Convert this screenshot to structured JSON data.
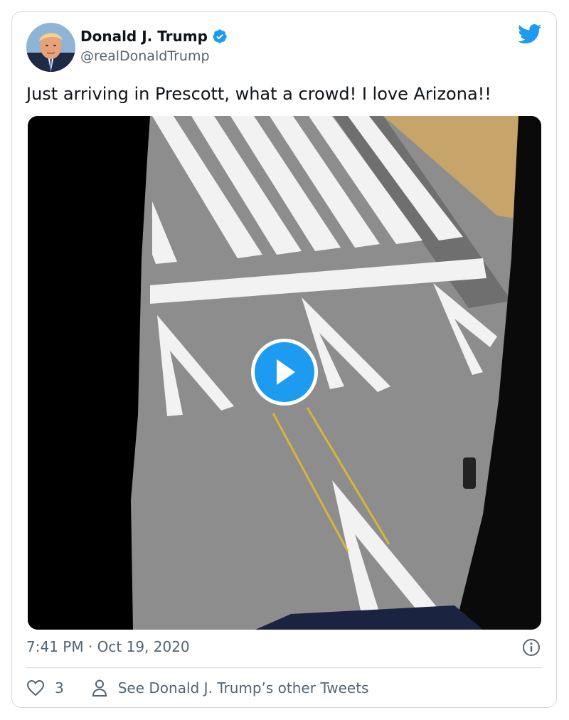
{
  "author": {
    "name": "Donald J. Trump",
    "handle": "@realDonaldTrump",
    "verified": true
  },
  "tweet": {
    "text": "Just arriving in Prescott, what a crowd! I love Arizona!!",
    "timestamp": "7:41 PM · Oct 19, 2020"
  },
  "media": {
    "type": "video",
    "play_icon": "play-icon"
  },
  "footer": {
    "like_count": "3",
    "other_tweets_label": "See Donald J. Trump’s other Tweets"
  },
  "icons": {
    "brand": "twitter-bird-icon",
    "verified": "verified-badge-icon",
    "info": "info-icon",
    "like": "heart-icon",
    "profile": "person-icon"
  },
  "colors": {
    "accent": "#1d9bf0",
    "text": "#0f1419",
    "secondary": "#536471",
    "border": "#cfd9de"
  }
}
